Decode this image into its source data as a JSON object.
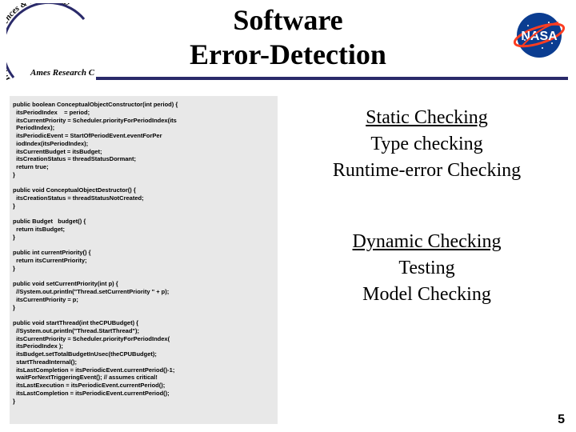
{
  "title_line1": "Software",
  "title_line2": "Error-Detection",
  "logo_left": {
    "curve_top_text": "Information Sciences & Technology",
    "bottom_text": "Ames Research Center"
  },
  "logo_right": {
    "text": "NASA"
  },
  "code_lines": [
    "public boolean ConceptualObjectConstructor(int period) {",
    "  itsPeriodIndex    = period;",
    "  itsCurrentPriority = Scheduler.priorityForPeriodIndex(its",
    "  PeriodIndex);",
    "  itsPeriodicEvent = StartOfPeriodEvent.eventForPer",
    "  iodIndex(itsPeriodIndex);",
    "  itsCurrentBudget = itsBudget;",
    "  itsCreationStatus = threadStatusDormant;",
    "  return true;",
    "}",
    "",
    "public void ConceptualObjectDestructor() {",
    "  itsCreationStatus = threadStatusNotCreated;",
    "}",
    "",
    "public Budget   budget() {",
    "  return itsBudget;",
    "}",
    "",
    "public int currentPriority() {",
    "  return itsCurrentPriority;",
    "}",
    "",
    "public void setCurrentPriority(int p) {",
    "  //System.out.println(\"Thread.setCurrentPriority \" + p);",
    "  itsCurrentPriority = p;",
    "}",
    "",
    "public void startThread(int theCPUBudget) {",
    "  //System.out.println(\"Thread.StartThread\");",
    "  itsCurrentPriority = Scheduler.priorityForPeriodIndex(",
    "  itsPeriodIndex );",
    "  itsBudget.setTotalBudgetInUsec(theCPUBudget);",
    "  startThreadInternal();",
    "  itsLastCompletion = itsPeriodicEvent.currentPeriod()-1;",
    "  waitForNextTriggeringEvent(); // assumes critical!",
    "  itsLastExecution = itsPeriodicEvent.currentPeriod();",
    "  itsLastCompletion = itsPeriodicEvent.currentPeriod();",
    "}"
  ],
  "right": {
    "static_heading": "Static Checking",
    "type_checking": "Type checking",
    "runtime_checking": "Runtime-error Checking",
    "dynamic_heading": "Dynamic Checking",
    "testing": "Testing",
    "model_checking": "Model Checking"
  },
  "slide_number": "5"
}
